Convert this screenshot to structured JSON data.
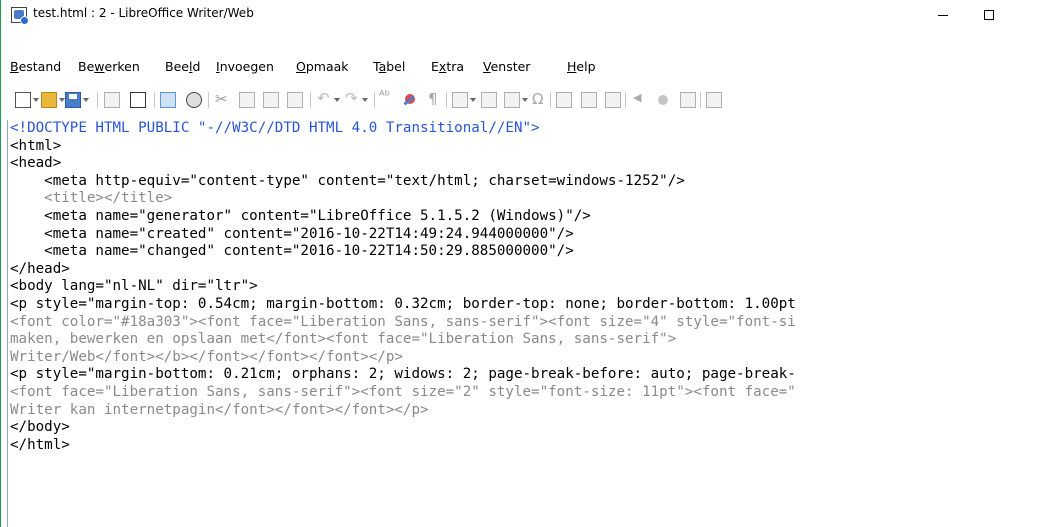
{
  "window": {
    "title": "test.html : 2 - LibreOffice Writer/Web"
  },
  "menu": {
    "items": [
      {
        "label": "Bestand",
        "mnemonic_index": 0
      },
      {
        "label": "Bewerken",
        "mnemonic_index": 2
      },
      {
        "label": "Beeld",
        "mnemonic_index": 3
      },
      {
        "label": "Invoegen",
        "mnemonic_index": 0
      },
      {
        "label": "Opmaak",
        "mnemonic_index": 0
      },
      {
        "label": "Tabel",
        "mnemonic_index": 1
      },
      {
        "label": "Extra",
        "mnemonic_index": 1
      },
      {
        "label": "Venster",
        "mnemonic_index": 0
      },
      {
        "label": "Help",
        "mnemonic_index": 0
      }
    ]
  },
  "toolbar": {
    "buttons": [
      {
        "name": "new-document-icon"
      },
      {
        "name": "open-folder-icon"
      },
      {
        "name": "save-icon"
      },
      {
        "name": "edit-file-icon"
      },
      {
        "name": "export-pdf-icon"
      },
      {
        "name": "html-source-icon"
      },
      {
        "name": "web-preview-icon"
      },
      {
        "name": "cut-icon"
      },
      {
        "name": "copy-icon"
      },
      {
        "name": "paste-icon"
      },
      {
        "name": "clone-formatting-icon"
      },
      {
        "name": "undo-icon"
      },
      {
        "name": "redo-icon"
      },
      {
        "name": "spelling-icon"
      },
      {
        "name": "autospellcheck-icon"
      },
      {
        "name": "formatting-marks-icon"
      },
      {
        "name": "insert-table-icon"
      },
      {
        "name": "insert-image-icon"
      },
      {
        "name": "insert-textbox-icon"
      },
      {
        "name": "special-character-icon"
      },
      {
        "name": "insert-hyperlink-icon"
      },
      {
        "name": "insert-footnote-icon"
      },
      {
        "name": "insert-comment-icon"
      },
      {
        "name": "navigator-icon"
      },
      {
        "name": "gallery-icon"
      },
      {
        "name": "data-sources-icon"
      },
      {
        "name": "draw-functions-icon"
      }
    ]
  },
  "editor": {
    "lines": [
      {
        "text": "<!DOCTYPE HTML PUBLIC \"-//W3C//DTD HTML 4.0 Transitional//EN\">",
        "color": "#2a54d8"
      },
      {
        "text": "<html>",
        "color": "#000000"
      },
      {
        "text": "<head>",
        "color": "#000000"
      },
      {
        "text": "    <meta http-equiv=\"content-type\" content=\"text/html; charset=windows-1252\"/>",
        "color": "#000000"
      },
      {
        "text": "    <title></title>",
        "color": "#8a8a8a"
      },
      {
        "text": "    <meta name=\"generator\" content=\"LibreOffice 5.1.5.2 (Windows)\"/>",
        "color": "#000000"
      },
      {
        "text": "    <meta name=\"created\" content=\"2016-10-22T14:49:24.944000000\"/>",
        "color": "#000000"
      },
      {
        "text": "    <meta name=\"changed\" content=\"2016-10-22T14:50:29.885000000\"/>",
        "color": "#000000"
      },
      {
        "text": "</head>",
        "color": "#000000"
      },
      {
        "text": "<body lang=\"nl-NL\" dir=\"ltr\">",
        "color": "#000000"
      },
      {
        "text": "<p style=\"margin-top: 0.54cm; margin-bottom: 0.32cm; border-top: none; border-bottom: 1.00pt",
        "color": "#000000"
      },
      {
        "text": "<font color=\"#18a303\"><font face=\"Liberation Sans, sans-serif\"><font size=\"4\" style=\"font-si",
        "color": "#8a8a8a"
      },
      {
        "text": "maken, bewerken en opslaan met</font><font face=\"Liberation Sans, sans-serif\">",
        "color": "#8a8a8a"
      },
      {
        "text": "Writer/Web</font></b></font></font></font></p>",
        "color": "#8a8a8a"
      },
      {
        "text": "<p style=\"margin-bottom: 0.21cm; orphans: 2; widows: 2; page-break-before: auto; page-break-",
        "color": "#000000"
      },
      {
        "text": "<font face=\"Liberation Sans, sans-serif\"><font size=\"2\" style=\"font-size: 11pt\"><font face=\"",
        "color": "#8a8a8a"
      },
      {
        "text": "Writer kan internetpagin</font></font></font></p>",
        "color": "#8a8a8a"
      },
      {
        "text": "</body>",
        "color": "#000000"
      },
      {
        "text": "</html>",
        "color": "#000000"
      }
    ]
  }
}
